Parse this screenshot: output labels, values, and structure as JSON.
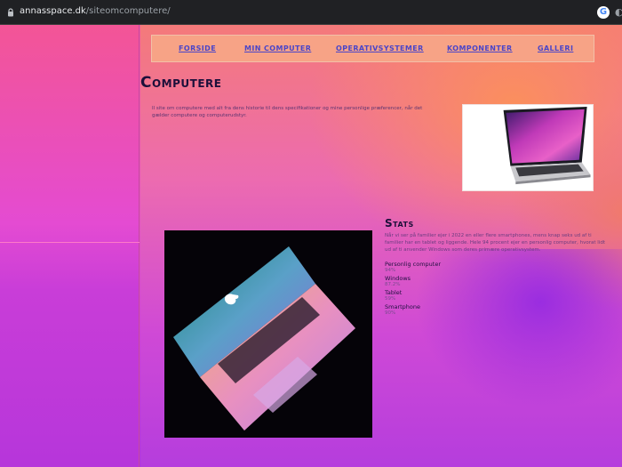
{
  "browser": {
    "url_domain": "annasspace.dk",
    "url_path": "/siteomcomputere/"
  },
  "nav": {
    "items": [
      "Forside",
      "Min computer",
      "Operativsystemer",
      "Komponenter",
      "Galleri"
    ]
  },
  "page": {
    "title": "Computere",
    "intro": "Il site om computere med alt fra dens historie til dens specifikationer og mine personlige præferencer, når det gælder computere og computerudstyr."
  },
  "stats": {
    "title": "Stats",
    "text": "Når vi ser på familier ejer i 2022 en eller flere smartphones, mens knap seks ud af ti familier har en tablet og liggende. Hele 94 procent ejer en personlig computer, hvorat lidt ud af ti anvender Windows som deres primære operativsystem.",
    "items": [
      {
        "label": "Personlig computer",
        "value": "94%"
      },
      {
        "label": "Windows",
        "value": "87.2%"
      },
      {
        "label": "Tablet",
        "value": "59%"
      },
      {
        "label": "Smartphone",
        "value": "90%"
      }
    ]
  }
}
